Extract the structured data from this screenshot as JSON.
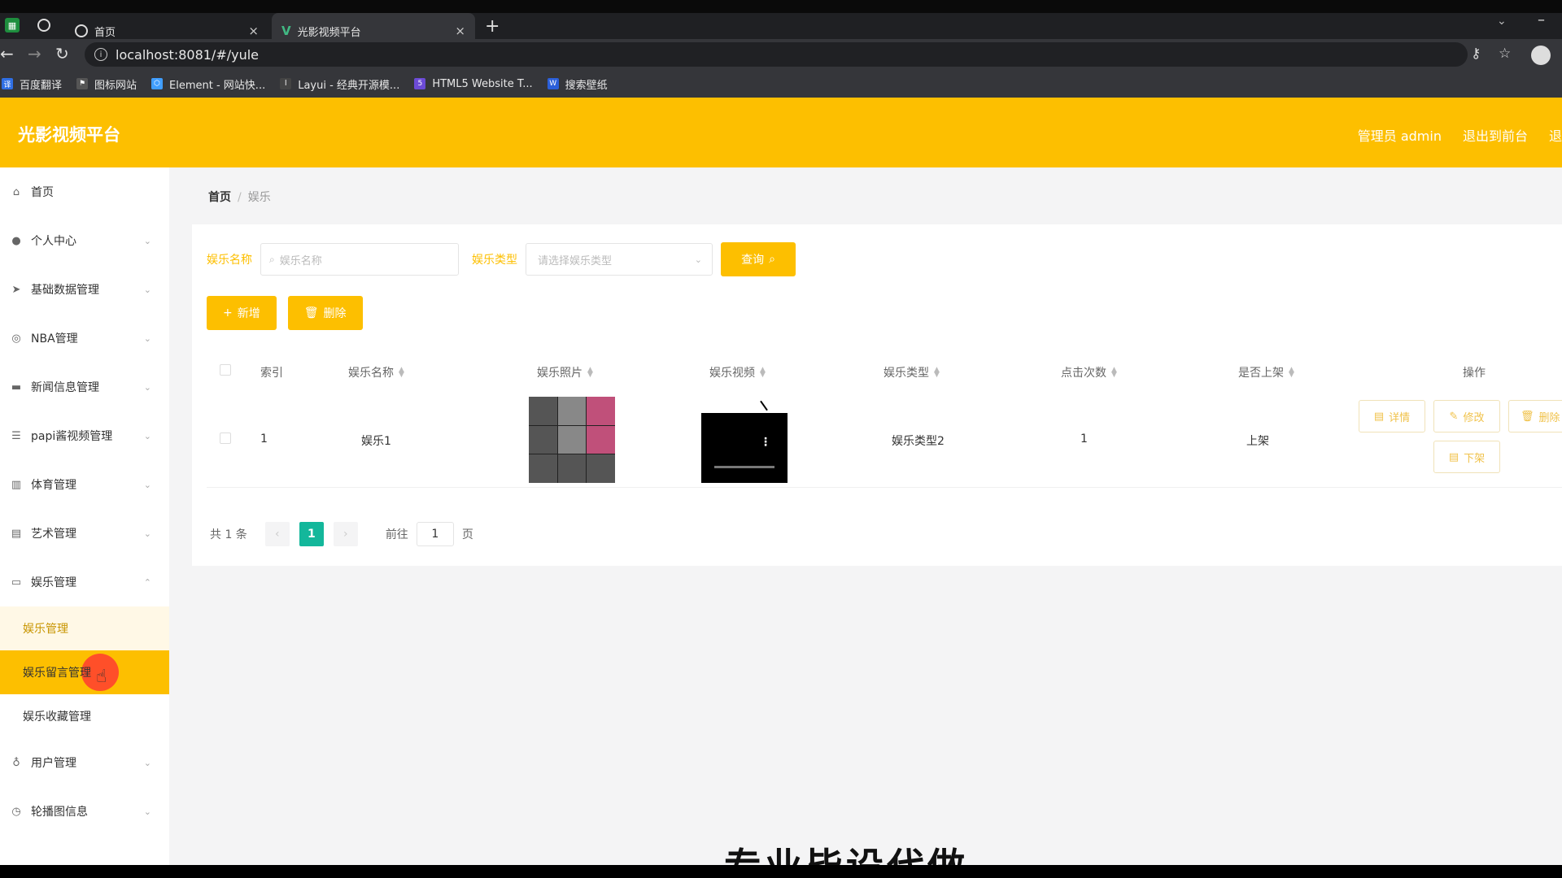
{
  "browser": {
    "tabs": [
      {
        "label": "首页",
        "close": "×"
      },
      {
        "label": "光影视频平台",
        "close": "×"
      }
    ],
    "new_tab": "+",
    "url": "localhost:8081/#/yule",
    "bookmarks": [
      "百度翻译",
      "图标网站",
      "Element - 网站快...",
      "Layui - 经典开源模...",
      "HTML5 Website T...",
      "搜索壁纸"
    ]
  },
  "header": {
    "brand": "光影视频平台",
    "admin": "管理员 admin",
    "front": "退出到前台",
    "logout": "退"
  },
  "sidebar": {
    "items": [
      {
        "label": "首页",
        "icon": "home-icon"
      },
      {
        "label": "个人中心",
        "icon": "user-icon"
      },
      {
        "label": "基础数据管理",
        "icon": "send-icon"
      },
      {
        "label": "NBA管理",
        "icon": "ball-icon"
      },
      {
        "label": "新闻信息管理",
        "icon": "news-icon"
      },
      {
        "label": "papi酱视频管理",
        "icon": "list-icon"
      },
      {
        "label": "体育管理",
        "icon": "chart-icon"
      },
      {
        "label": "艺术管理",
        "icon": "art-icon"
      },
      {
        "label": "娱乐管理",
        "icon": "chat-icon"
      },
      {
        "label": "用户管理",
        "icon": "mic-icon"
      },
      {
        "label": "轮播图信息",
        "icon": "clock-icon"
      }
    ],
    "sub_items": [
      "娱乐管理",
      "娱乐留言管理",
      "娱乐收藏管理"
    ]
  },
  "breadcrumb": {
    "home": "首页",
    "sep": "/",
    "current": "娱乐"
  },
  "search": {
    "name_label": "娱乐名称",
    "name_placeholder": "娱乐名称",
    "type_label": "娱乐类型",
    "type_placeholder": "请选择娱乐类型",
    "query_button": "查询"
  },
  "actions": {
    "add": "新增",
    "delete": "删除"
  },
  "table": {
    "columns": [
      "索引",
      "娱乐名称",
      "娱乐照片",
      "娱乐视频",
      "娱乐类型",
      "点击次数",
      "是否上架",
      "操作"
    ],
    "rows": [
      {
        "index": "1",
        "name": "娱乐1",
        "type": "娱乐类型2",
        "clicks": "1",
        "status": "上架"
      }
    ],
    "row_ops": [
      "详情",
      "修改",
      "删除",
      "下架"
    ]
  },
  "pager": {
    "total": "共 1 条",
    "current": "1",
    "goto_prefix": "前往",
    "goto_value": "1",
    "goto_suffix": "页"
  },
  "overlay_caption": "专业毕设代做",
  "colors": {
    "accent": "#fdbf00",
    "pager_active": "#13b79b"
  }
}
